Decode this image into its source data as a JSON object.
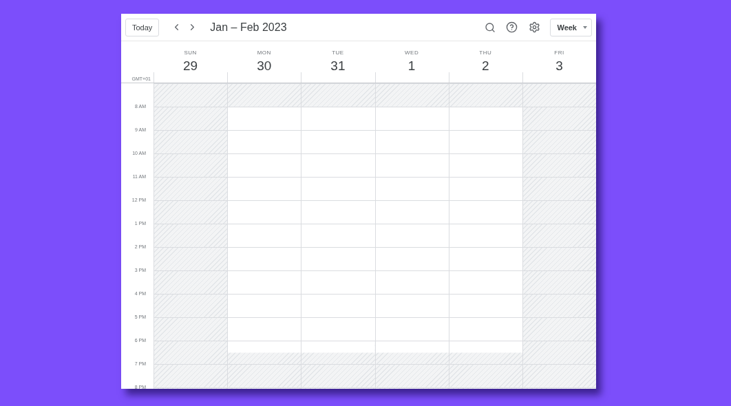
{
  "toolbar": {
    "today": "Today",
    "title": "Jan – Feb 2023",
    "view": "Week"
  },
  "timezone": "GMT+01",
  "days": [
    {
      "weekday": "SUN",
      "date": "29",
      "workday": false
    },
    {
      "weekday": "MON",
      "date": "30",
      "workday": true
    },
    {
      "weekday": "TUE",
      "date": "31",
      "workday": true
    },
    {
      "weekday": "WED",
      "date": "1",
      "workday": true
    },
    {
      "weekday": "THU",
      "date": "2",
      "workday": true
    },
    {
      "weekday": "FRI",
      "date": "3",
      "workday": false
    }
  ],
  "hours": [
    {
      "available": false
    },
    {
      "label": "8 AM",
      "available": true,
      "partial": false
    },
    {
      "label": "9 AM",
      "available": true,
      "partial": false
    },
    {
      "label": "10 AM",
      "available": true,
      "partial": false
    },
    {
      "label": "11 AM",
      "available": true,
      "partial": false
    },
    {
      "label": "12 PM",
      "available": true,
      "partial": false
    },
    {
      "label": "1 PM",
      "available": true,
      "partial": false
    },
    {
      "label": "2 PM",
      "available": true,
      "partial": false
    },
    {
      "label": "3 PM",
      "available": true,
      "partial": false
    },
    {
      "label": "4 PM",
      "available": true,
      "partial": false
    },
    {
      "label": "5 PM",
      "available": true,
      "partial": false
    },
    {
      "label": "6 PM",
      "available": true,
      "partial": true
    },
    {
      "label": "7 PM",
      "available": false
    },
    {
      "label": "8 PM",
      "available": false
    }
  ]
}
